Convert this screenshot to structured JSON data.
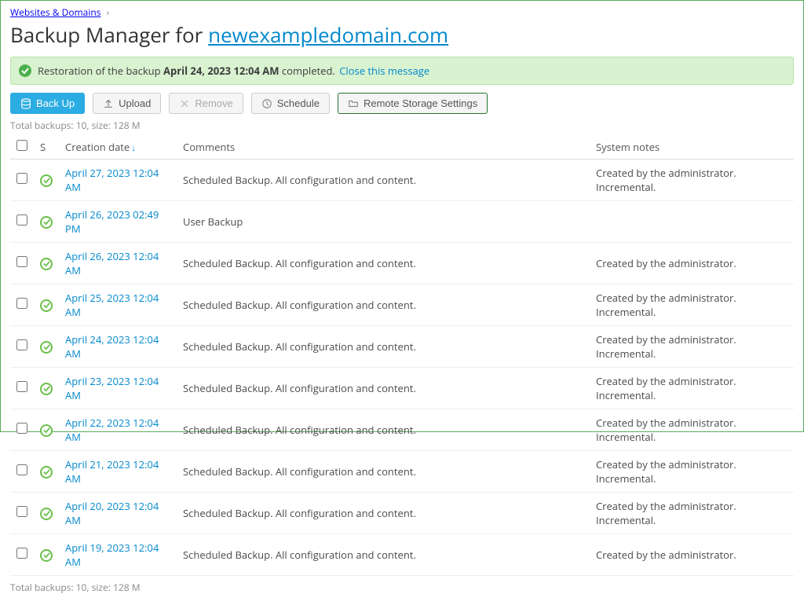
{
  "breadcrumb": {
    "label": "Websites & Domains"
  },
  "title": {
    "prefix": "Backup Manager for ",
    "domain": "newexampledomain.com"
  },
  "alert": {
    "text_prefix": "Restoration of the backup ",
    "bold": "April 24, 2023 12:04 AM",
    "text_suffix": " completed. ",
    "close": "Close this message"
  },
  "toolbar": {
    "backup": "Back Up",
    "upload": "Upload",
    "remove": "Remove",
    "schedule": "Schedule",
    "remote": "Remote Storage Settings"
  },
  "totals": "Total backups: 10, size: 128 M",
  "headers": {
    "status": "S",
    "date": "Creation date",
    "comments": "Comments",
    "notes": "System notes"
  },
  "rows": [
    {
      "date": "April 27, 2023 12:04 AM",
      "comments": "Scheduled Backup. All configuration and content.",
      "notes": "Created by the administrator. Incremental."
    },
    {
      "date": "April 26, 2023 02:49 PM",
      "comments": "User Backup",
      "notes": ""
    },
    {
      "date": "April 26, 2023 12:04 AM",
      "comments": "Scheduled Backup. All configuration and content.",
      "notes": "Created by the administrator."
    },
    {
      "date": "April 25, 2023 12:04 AM",
      "comments": "Scheduled Backup. All configuration and content.",
      "notes": "Created by the administrator. Incremental."
    },
    {
      "date": "April 24, 2023 12:04 AM",
      "comments": "Scheduled Backup. All configuration and content.",
      "notes": "Created by the administrator. Incremental."
    },
    {
      "date": "April 23, 2023 12:04 AM",
      "comments": "Scheduled Backup. All configuration and content.",
      "notes": "Created by the administrator. Incremental."
    },
    {
      "date": "April 22, 2023 12:04 AM",
      "comments": "Scheduled Backup. All configuration and content.",
      "notes": "Created by the administrator. Incremental."
    },
    {
      "date": "April 21, 2023 12:04 AM",
      "comments": "Scheduled Backup. All configuration and content.",
      "notes": "Created by the administrator. Incremental."
    },
    {
      "date": "April 20, 2023 12:04 AM",
      "comments": "Scheduled Backup. All configuration and content.",
      "notes": "Created by the administrator. Incremental."
    },
    {
      "date": "April 19, 2023 12:04 AM",
      "comments": "Scheduled Backup. All configuration and content.",
      "notes": "Created by the administrator."
    }
  ]
}
